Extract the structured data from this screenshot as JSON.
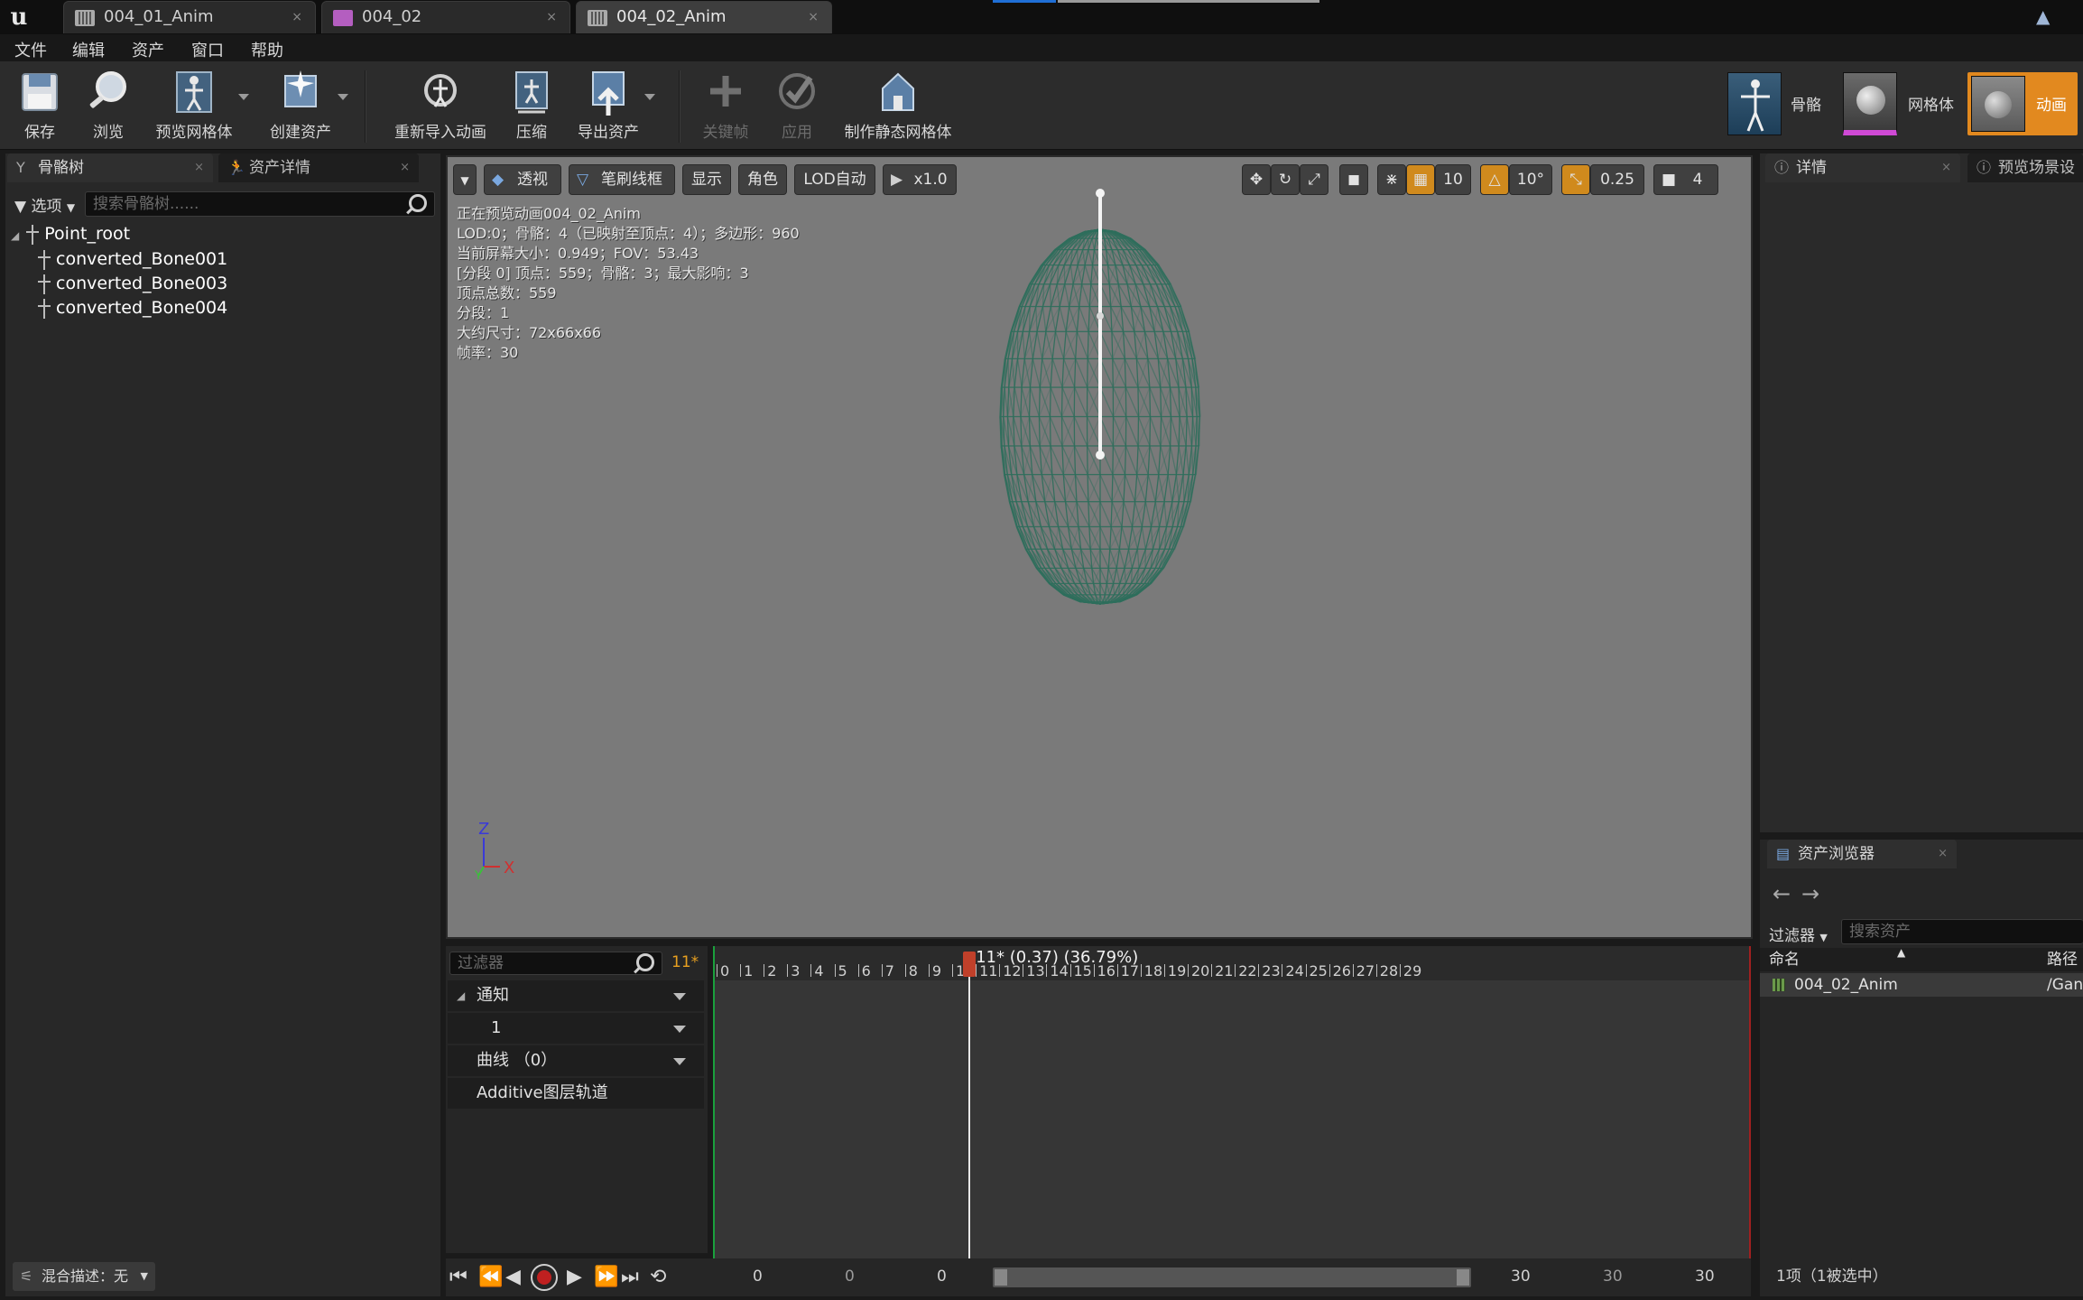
{
  "tabs": [
    {
      "label": "004_01_Anim",
      "icon": "anim-sequence-icon"
    },
    {
      "label": "004_02",
      "icon": "skeletal-mesh-icon"
    },
    {
      "label": "004_02_Anim",
      "icon": "anim-sequence-icon",
      "active": true
    }
  ],
  "menu": [
    "文件",
    "编辑",
    "资产",
    "窗口",
    "帮助"
  ],
  "toolbar": {
    "save": "保存",
    "browse": "浏览",
    "preview_mesh": "预览网格体",
    "create_asset": "创建资产",
    "reimport": "重新导入动画",
    "compress": "压缩",
    "export": "导出资产",
    "keyframe": "关键帧",
    "apply": "应用",
    "make_static_mesh": "制作静态网格体"
  },
  "modes": {
    "skeleton": "骨骼",
    "mesh": "网格体",
    "animation": "动画"
  },
  "skeleton_panel": {
    "tab_skeleton_tree": "骨骼树",
    "tab_asset_details": "资产详情",
    "options": "选项",
    "search_placeholder": "搜索骨骼树......",
    "tree": [
      {
        "name": "Point_root",
        "level": 0
      },
      {
        "name": "converted_Bone001",
        "level": 1
      },
      {
        "name": "converted_Bone003",
        "level": 1
      },
      {
        "name": "converted_Bone004",
        "level": 1
      }
    ],
    "blend_label": "混合描述：无"
  },
  "viewport": {
    "perspective": "透视",
    "brush_wireframe": "笔刷线框",
    "show": "显示",
    "character": "角色",
    "lod": "LOD自动",
    "speed": "x1.0",
    "grid_snap": "10",
    "rot_snap": "10°",
    "scale_snap": "0.25",
    "cam_speed": "4",
    "stats": [
      "正在预览动画004_02_Anim",
      "LOD:0；骨骼：4（已映射至顶点：4）；多边形：960",
      "当前屏幕大小：0.949；FOV：53.43",
      "[分段 0] 顶点：559；骨骼：3；最大影响：3",
      "顶点总数：559",
      "分段：1",
      "大约尺寸：72x66x66",
      "帧率：30"
    ],
    "axis": {
      "z": "Z",
      "y": "Y",
      "x": "X"
    },
    "colors": {
      "mesh_wire": "#2e6e5c",
      "bone": "#f2f2f2",
      "background": "#7a7a7a"
    }
  },
  "timeline": {
    "filter_placeholder": "过滤器",
    "current_frame": "11*",
    "tracks": [
      "通知",
      "1",
      "曲线 （0）",
      "Additive图层轨道"
    ],
    "ticks": [
      "0",
      "1",
      "2",
      "3",
      "4",
      "5",
      "6",
      "7",
      "8",
      "9",
      "10",
      "11",
      "12",
      "13",
      "14",
      "15",
      "16",
      "17",
      "18",
      "19",
      "20",
      "21",
      "22",
      "23",
      "24",
      "25",
      "26",
      "27",
      "28",
      "29"
    ],
    "playhead_label": "11* (0.37) (36.79%)",
    "playhead_frame": 11,
    "total_frames": 30
  },
  "transport": {
    "nums": [
      "0",
      "0",
      "0",
      "30",
      "30",
      "30"
    ]
  },
  "details_panel": {
    "tab_details": "详情",
    "tab_preview_scene": "预览场景设"
  },
  "asset_browser": {
    "tab": "资产浏览器",
    "filter": "过滤器",
    "search_placeholder": "搜索资产",
    "col_name": "命名",
    "col_path": "路径",
    "rows": [
      {
        "name": "004_02_Anim",
        "path": "/Gan"
      }
    ],
    "status": "1项（1被选中）"
  }
}
